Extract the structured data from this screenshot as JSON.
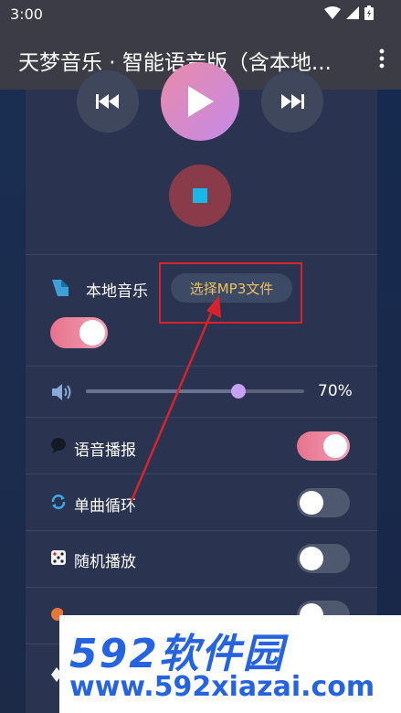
{
  "status": {
    "time": "3:00",
    "icons": [
      "wifi-icon",
      "signal-icon",
      "battery-icon"
    ]
  },
  "appbar": {
    "title": "天梦音乐 · 智能语音版（含本地...",
    "more_icon": "more-vert-icon"
  },
  "player": {
    "prev_icon": "skip-previous-icon",
    "play_icon": "play-icon",
    "next_icon": "skip-next-icon",
    "stop_icon": "stop-icon"
  },
  "local_music": {
    "label": "本地音乐",
    "button": "选择MP3文件",
    "enabled": true
  },
  "volume": {
    "value_text": "70%",
    "level": 0.7
  },
  "voice_broadcast": {
    "label": "语音播报",
    "enabled": true
  },
  "single_loop": {
    "label": "单曲循环",
    "enabled": false
  },
  "shuffle": {
    "label": "随机播放",
    "enabled": false
  },
  "watermark": {
    "logo": "592软件园",
    "url": "www.592xiazai.com"
  },
  "colors": {
    "accent_pink": "#e8728e",
    "annotation_red": "#d8222c",
    "watermark_blue": "#2563e0"
  }
}
